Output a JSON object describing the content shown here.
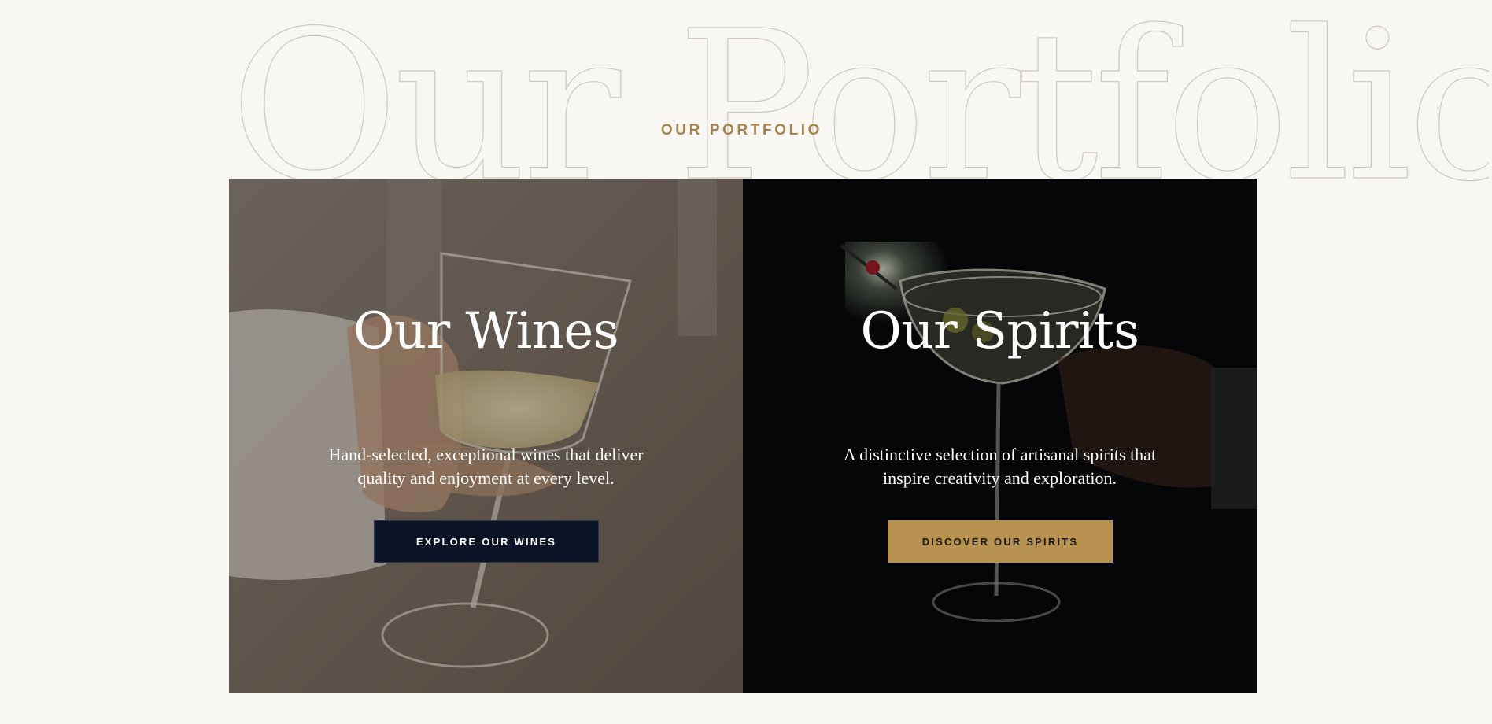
{
  "background_title": "Our Portfolio",
  "eyebrow": "OUR PORTFOLIO",
  "colors": {
    "page_bg": "#f8f7f3",
    "accent_gold": "#b8924e",
    "navy": "#0b1327",
    "text_light": "#ffffff"
  },
  "panels": [
    {
      "heading": "Our Wines",
      "description": "Hand-selected, exceptional wines that deliver quality and enjoyment at every level.",
      "button_label": "EXPLORE OUR WINES",
      "image": "wine-glass-hand-photo"
    },
    {
      "heading": "Our Spirits",
      "description": "A distinctive selection of artisanal spirits that inspire creativity and exploration.",
      "button_label": "DISCOVER OUR SPIRITS",
      "image": "cocktail-coupe-photo"
    }
  ]
}
